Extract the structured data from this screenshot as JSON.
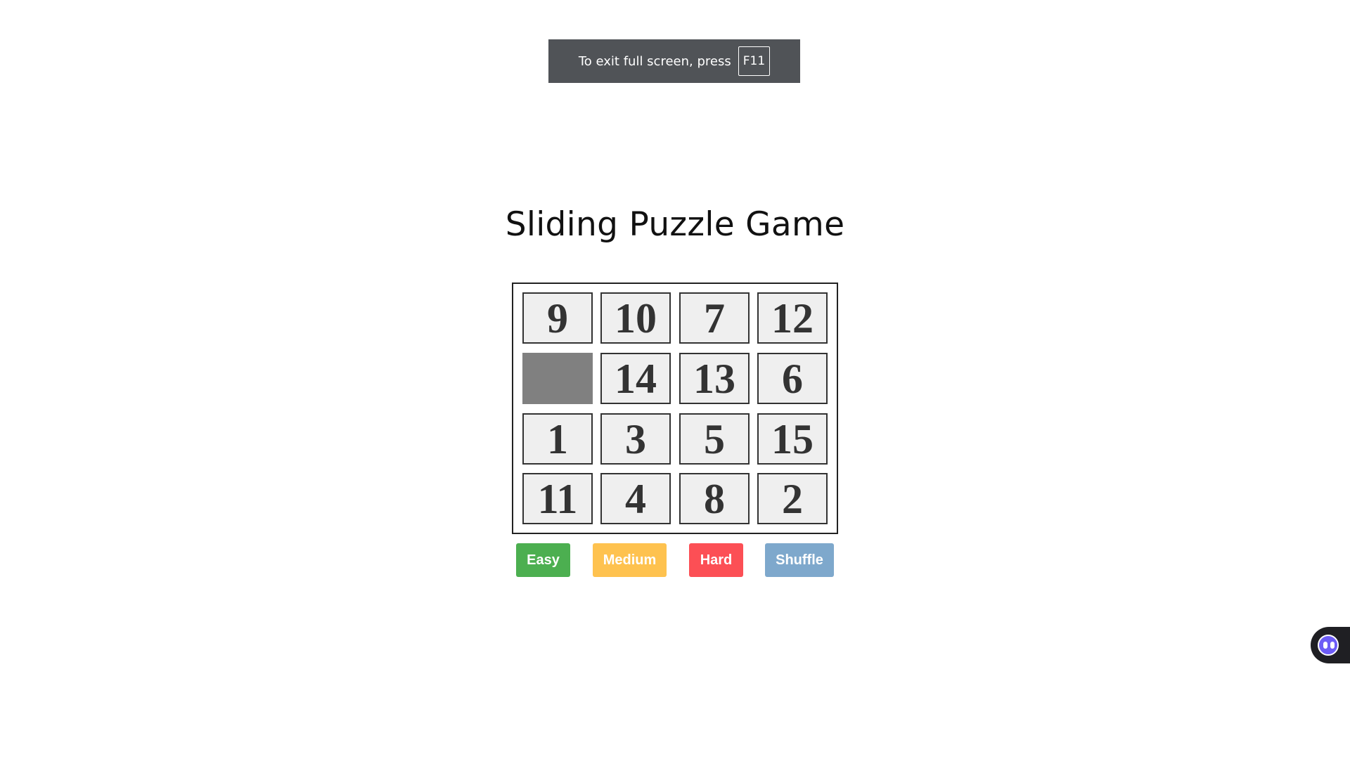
{
  "fullscreen_notice": {
    "message": "To exit full screen, press",
    "key": "F11"
  },
  "title": "Sliding Puzzle Game",
  "board": {
    "rows": 4,
    "cols": 4,
    "tiles": [
      [
        "9",
        "10",
        "7",
        "12"
      ],
      [
        "",
        "14",
        "13",
        "6"
      ],
      [
        "1",
        "3",
        "5",
        "15"
      ],
      [
        "11",
        "4",
        "8",
        "2"
      ]
    ]
  },
  "buttons": [
    {
      "id": "easy",
      "label": "Easy",
      "color": "#4caf50"
    },
    {
      "id": "medium",
      "label": "Medium",
      "color": "#fec24f"
    },
    {
      "id": "hard",
      "label": "Hard",
      "color": "#fc4f55"
    },
    {
      "id": "shuffle",
      "label": "Shuffle",
      "color": "#7ea8cc"
    }
  ],
  "assistant_widget": {
    "icon": "assistant-face-icon"
  }
}
